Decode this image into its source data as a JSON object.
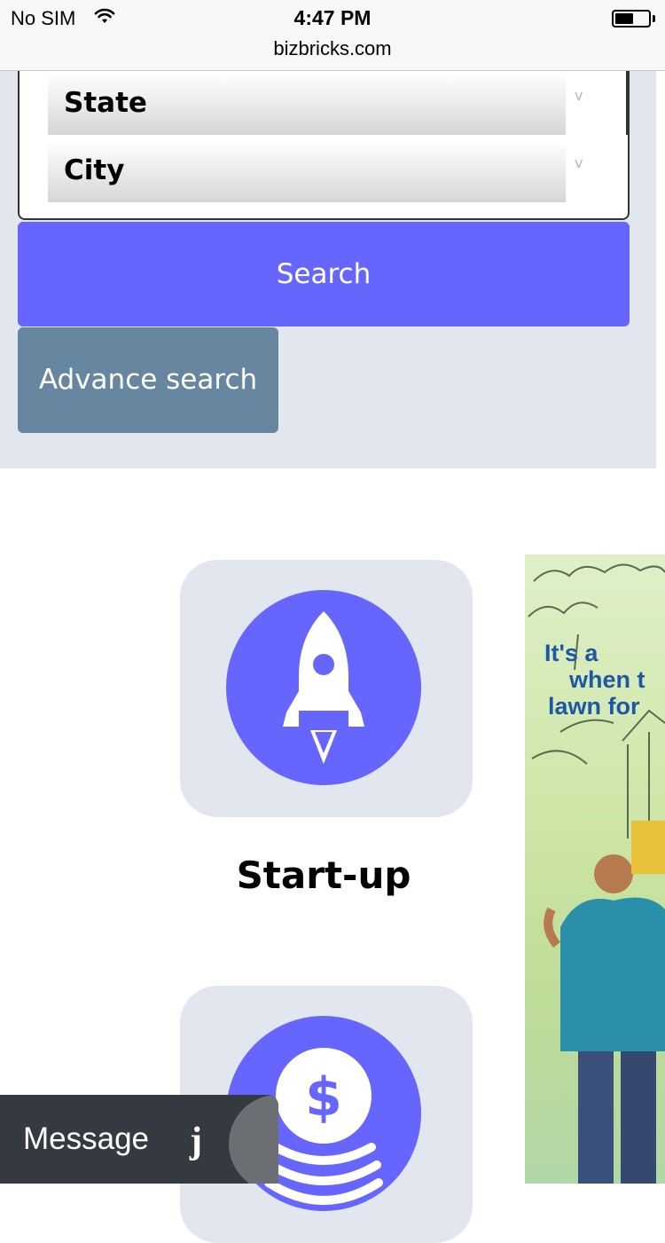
{
  "status_bar": {
    "carrier": "No SIM",
    "time": "4:47 PM",
    "battery_level": 0.55
  },
  "browser": {
    "url": "bizbricks.com"
  },
  "search_form": {
    "state_label": "State",
    "city_label": "City",
    "chevron": "v",
    "search_label": "Search",
    "advance_search_label": "Advance search"
  },
  "categories": [
    {
      "label": "Start-up",
      "icon": "rocket-icon"
    },
    {
      "label": "",
      "icon": "dollar-coins-icon"
    }
  ],
  "ad": {
    "lines": [
      "It's a",
      "when t",
      "lawn for"
    ]
  },
  "message_bar": {
    "label": "Message",
    "logo_glyph": "j"
  },
  "colors": {
    "accent": "#6666ff",
    "secondary_button": "#67869f",
    "panel_background": "#e2e6ee",
    "message_bar": "#353a41"
  }
}
